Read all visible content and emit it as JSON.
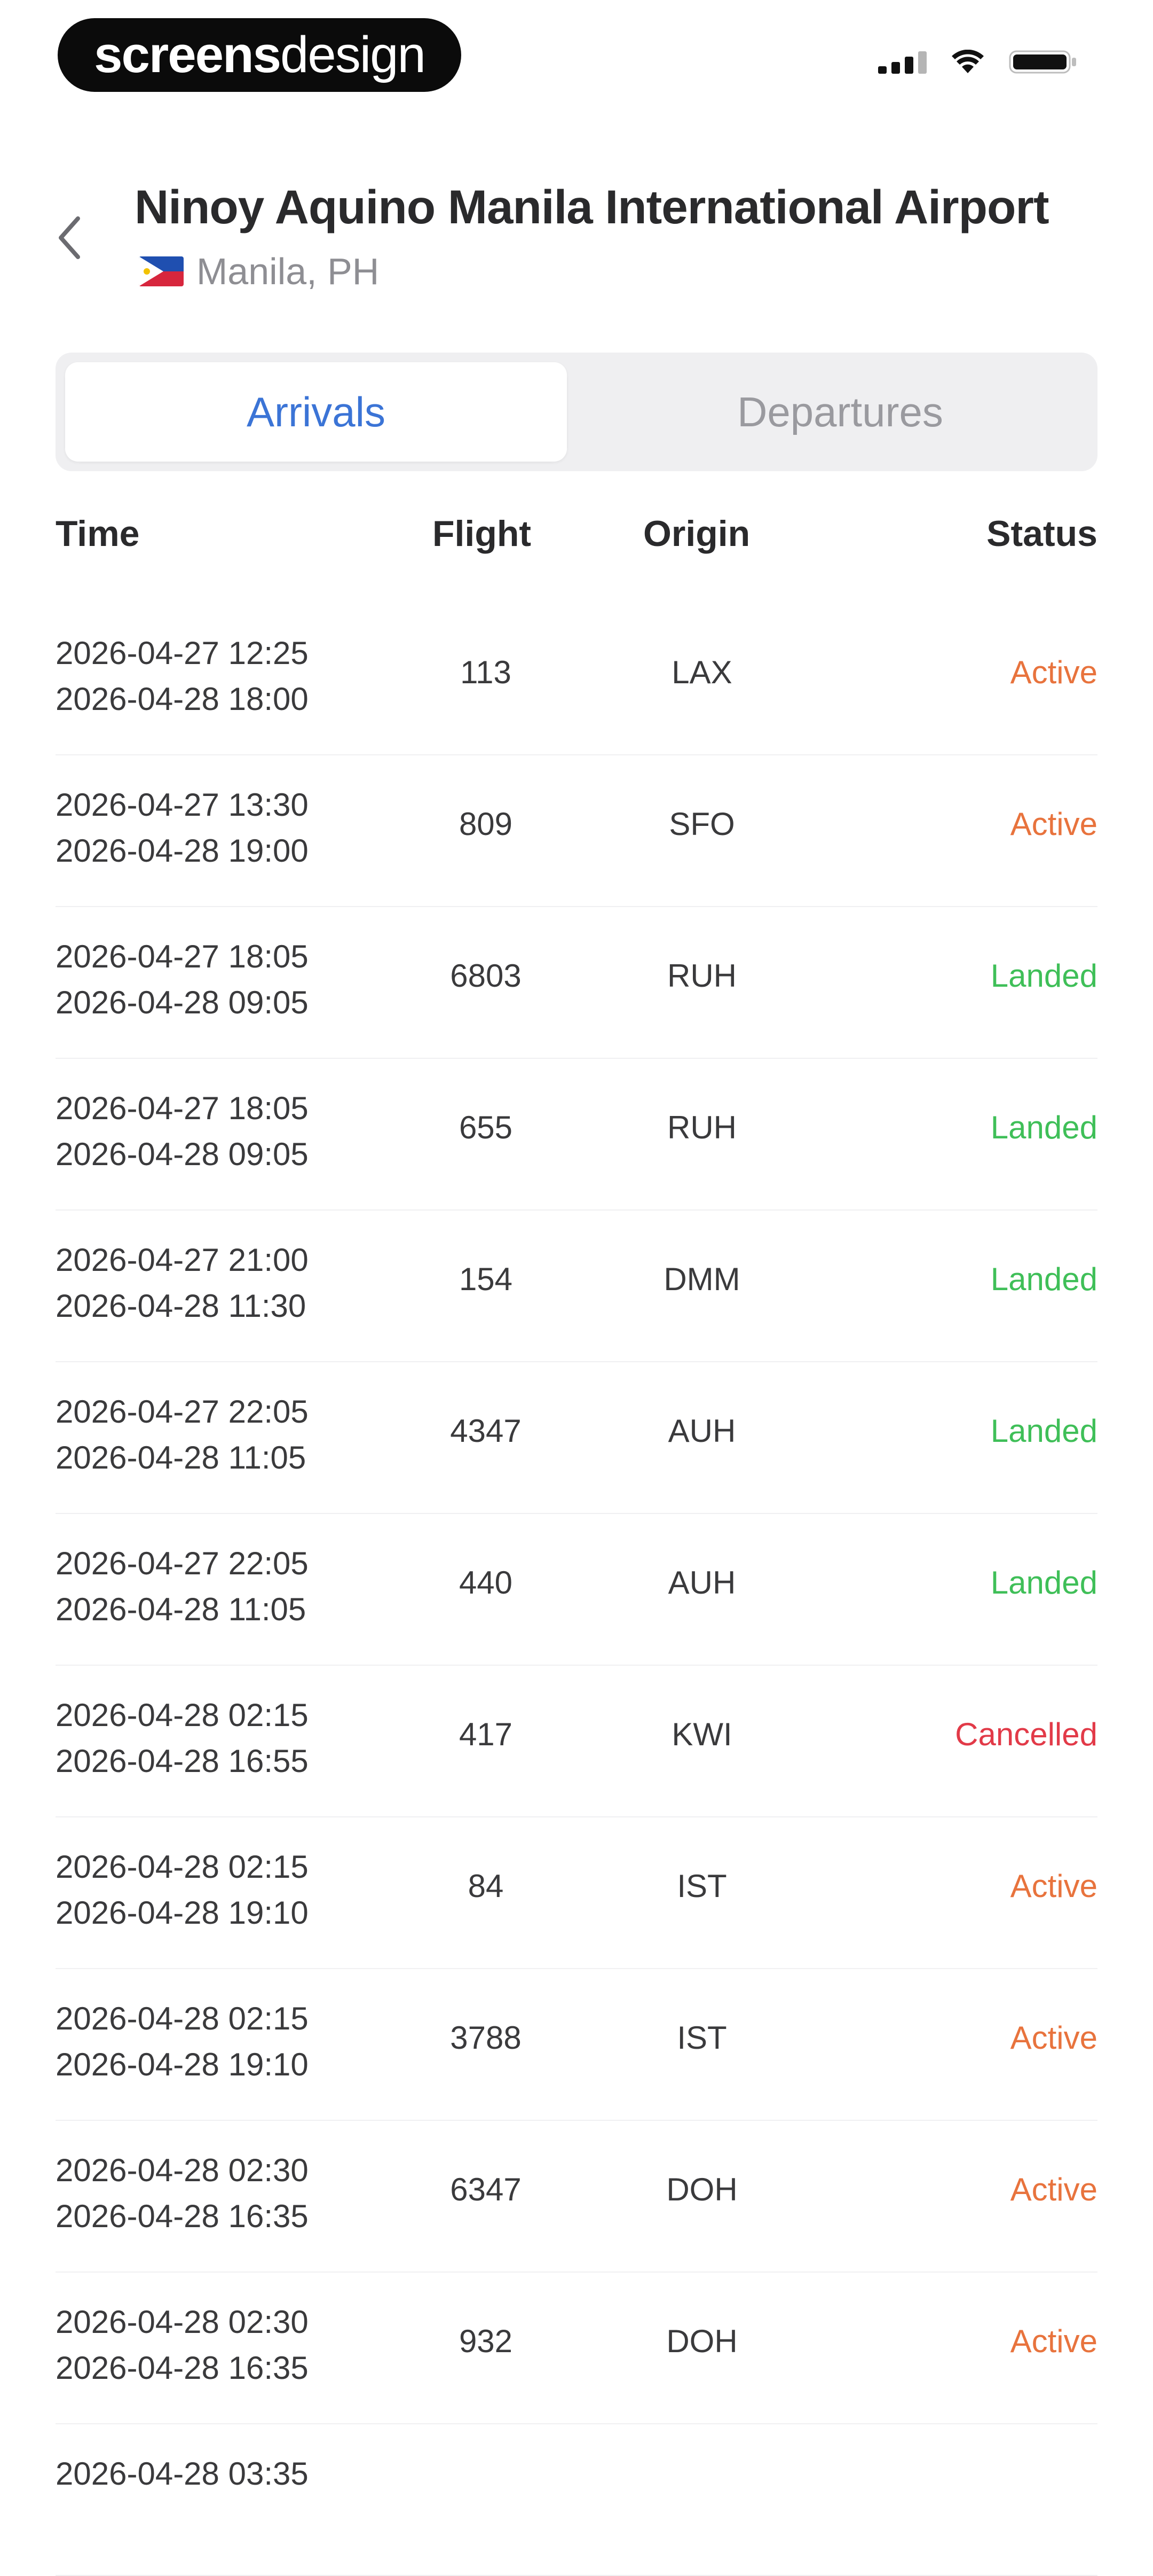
{
  "status_bar": {
    "brand_bold": "screens",
    "brand_light": "design"
  },
  "header": {
    "back_icon": "chevron-left-icon",
    "airport_name": "Ninoy Aquino Manila International Airport",
    "location": "Manila, PH",
    "flag_icon": "philippines-flag-icon"
  },
  "tabs": [
    {
      "label": "Arrivals",
      "selected": true
    },
    {
      "label": "Departures",
      "selected": false
    }
  ],
  "table": {
    "columns": [
      "Time",
      "Flight",
      "Origin",
      "Status"
    ],
    "rows": [
      {
        "time_1": "2026-04-27 12:25",
        "time_2": "2026-04-28 18:00",
        "flight": "113",
        "origin": "LAX",
        "status": "Active"
      },
      {
        "time_1": "2026-04-27 13:30",
        "time_2": "2026-04-28 19:00",
        "flight": "809",
        "origin": "SFO",
        "status": "Active"
      },
      {
        "time_1": "2026-04-27 18:05",
        "time_2": "2026-04-28 09:05",
        "flight": "6803",
        "origin": "RUH",
        "status": "Landed"
      },
      {
        "time_1": "2026-04-27 18:05",
        "time_2": "2026-04-28 09:05",
        "flight": "655",
        "origin": "RUH",
        "status": "Landed"
      },
      {
        "time_1": "2026-04-27 21:00",
        "time_2": "2026-04-28 11:30",
        "flight": "154",
        "origin": "DMM",
        "status": "Landed"
      },
      {
        "time_1": "2026-04-27 22:05",
        "time_2": "2026-04-28 11:05",
        "flight": "4347",
        "origin": "AUH",
        "status": "Landed"
      },
      {
        "time_1": "2026-04-27 22:05",
        "time_2": "2026-04-28 11:05",
        "flight": "440",
        "origin": "AUH",
        "status": "Landed"
      },
      {
        "time_1": "2026-04-28 02:15",
        "time_2": "2026-04-28 16:55",
        "flight": "417",
        "origin": "KWI",
        "status": "Cancelled"
      },
      {
        "time_1": "2026-04-28 02:15",
        "time_2": "2026-04-28 19:10",
        "flight": "84",
        "origin": "IST",
        "status": "Active"
      },
      {
        "time_1": "2026-04-28 02:15",
        "time_2": "2026-04-28 19:10",
        "flight": "3788",
        "origin": "IST",
        "status": "Active"
      },
      {
        "time_1": "2026-04-28 02:30",
        "time_2": "2026-04-28 16:35",
        "flight": "6347",
        "origin": "DOH",
        "status": "Active"
      },
      {
        "time_1": "2026-04-28 02:30",
        "time_2": "2026-04-28 16:35",
        "flight": "932",
        "origin": "DOH",
        "status": "Active"
      },
      {
        "time_1": "2026-04-28 03:35",
        "time_2": "",
        "flight": "",
        "origin": "",
        "status": ""
      }
    ]
  },
  "colors": {
    "accent": "#3b74d6",
    "active": "#e8733d",
    "landed": "#3fbf58",
    "cancelled": "#e23a48"
  }
}
